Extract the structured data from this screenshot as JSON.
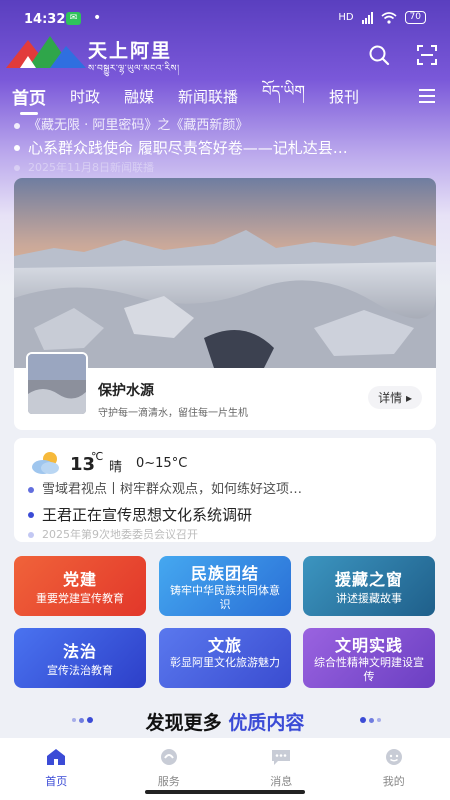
{
  "status_bar": {
    "time": "14:32",
    "dot": "•",
    "network": "HD",
    "battery": "70"
  },
  "brand": {
    "title": "天上阿里",
    "subtitle": "ས་བསྒྱུར་ལྷ་ཡུལ་མངའ་རིས།"
  },
  "top_icons": [
    "search-icon",
    "scan-icon"
  ],
  "tabs": [
    "首页",
    "时政",
    "融媒",
    "新闻联播",
    "བོད་ཡིག",
    "报刊"
  ],
  "ticker": [
    "《藏无限 · 阿里密码》之《藏西新颜》",
    "心系群众践使命 履职尽责答好卷——记札达县…",
    "2025年11月8日新闻联播"
  ],
  "banner": {
    "title": "保护水源",
    "subtitle": "守护每一滴清水，留住每一片生机",
    "more": "详情 ▸"
  },
  "weather": {
    "temp": "13",
    "unit": "℃",
    "condition": "晴",
    "range": "0~15°C",
    "news": [
      "雪域君视点丨树牢群众观点，如何练好这项…",
      "王君正在宣传思想文化系统调研",
      "2025年第9次地委委员会议召开"
    ]
  },
  "cards": [
    {
      "title": "党建",
      "subtitle": "重要党建宣传教育",
      "color": "#e8452c"
    },
    {
      "title": "民族团结",
      "subtitle": "铸牢中华民族共同体意识",
      "color": "#2f8fe0"
    },
    {
      "title": "援藏之窗",
      "subtitle": "讲述援藏故事",
      "color": "#2a7ea8"
    },
    {
      "title": "法治",
      "subtitle": "宣传法治教育",
      "color": "#3557e0"
    },
    {
      "title": "文旅",
      "subtitle": "彰显阿里文化旅游魅力",
      "color": "#4a5fe0"
    },
    {
      "title": "文明实践",
      "subtitle": "综合性精神文明建设宣传",
      "color": "#8a4fcf"
    }
  ],
  "discover": {
    "part1": "发现更多",
    "part2": "优质内容"
  },
  "bottom_nav": [
    "首页",
    "服务",
    "消息",
    "我的"
  ],
  "colors": {
    "accent": "#3b4bd6",
    "header_purple": "#5a3fbf"
  }
}
